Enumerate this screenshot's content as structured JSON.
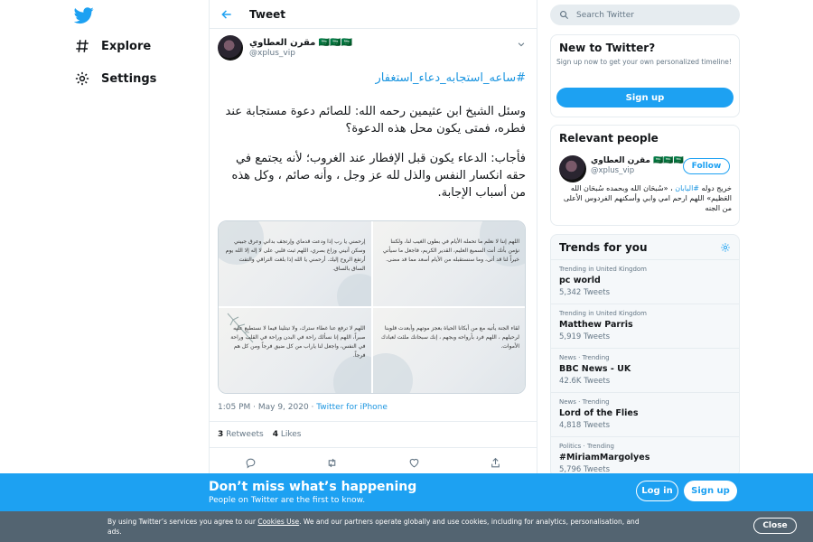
{
  "colors": {
    "accent": "#1da1f2",
    "link": "#1b95e0",
    "muted": "#657786",
    "cookie_bg": "#536471"
  },
  "nav": {
    "logo_icon": "twitter-bird-icon",
    "items": [
      {
        "label": "Explore",
        "icon": "hashtag-icon"
      },
      {
        "label": "Settings",
        "icon": "gear-icon"
      }
    ]
  },
  "header": {
    "title": "Tweet",
    "back_icon": "arrow-left-icon"
  },
  "tweet": {
    "author_name": "مقرن العطاوي 🇸🇦🇸🇦🇸🇦",
    "author_handle": "@xplus_vip",
    "hashtag": "#ساعه_استجابه_دعاء_استغفار",
    "paragraph1": "وسئل الشيخ ابن عثيمين رحمه الله: للصائم دعوة مستجابة عند فطره، فمتى يكون محل هذه الدعوة؟",
    "paragraph2": "فأجاب: الدعاء يكون قبل الإفطار عند الغروب؛ لأنه يجتمع في حقه انكسار النفس والذل لله عز وجل ، وأنه صائم ، وكل هذه من أسباب الإجابة.",
    "images": [
      {
        "text": "اللهم إننا لا نعلم ما تحمله الأيام في بطون الغيب لنا، ولكننا نؤمن بأنك أنت السميع العليم، القدير الكريم، فاجعل ما سيأتي خيراً لنا قد أتى، وما سنستقبله من الأيام أسعد مما قد مضى."
      },
      {
        "text": "إرحمني يا رب إذا ودعت قدماي وإرتجف بداني وعرق جبيني وسكن أنيني وزاغ بصري، اللهم ثبت قلبي على لا إله إلا الله يوم أرتفع الروح إليك. أرحمني يا الله إذا بلغت التراقي والتفت الساق بالساق."
      },
      {
        "text": "لقاء الجنة يأتيه مع من أبكانا الحياة بعجز موتهم وأبعدت قلوبنا لرحيلهم ، اللهم فرد بأرواحه وبجهم ، إنك سبحانك ملئت لعبادك الأموات."
      },
      {
        "text": "اللهم لا ترفع عنا غطاء سترك، ولا تبتلينا فيما لا نستطيع عليه صبراً، اللهم إنا نسألك راحة في البدن وراحة في القلب وراحة في النفس، واجعل لنا ياراب من كل ضيق فرجاً ومن كل هم فرجاً."
      }
    ],
    "timestamp": "1:05 PM · May 9, 2020 · ",
    "source": "Twitter for iPhone",
    "retweets_count": "3",
    "retweets_label": "Retweets",
    "likes_count": "4",
    "likes_label": "Likes",
    "actions": [
      "reply-icon",
      "retweet-icon",
      "like-icon",
      "share-icon"
    ]
  },
  "search": {
    "placeholder": "Search Twitter"
  },
  "new_to_twitter": {
    "title": "New to Twitter?",
    "description": "Sign up now to get your own personalized timeline!",
    "button": "Sign up"
  },
  "relevant": {
    "title": "Relevant people",
    "name": "مقرن العطاوي 🇸🇦🇸🇦🇸🇦",
    "handle": "@xplus_vip",
    "follow": "Follow",
    "bio_prefix": "خريج دوله ",
    "bio_hashtag": "#اليابان",
    "bio_rest": " ، «سُبحَان الله وبحمده سُبحَان الله العَظيم» اللهم ارحم امي وابي وأسكنهم الفردوس الأعلى من الجنه"
  },
  "trends": {
    "title": "Trends for you",
    "items": [
      {
        "context": "Trending in United Kingdom",
        "name": "pc world",
        "count": "5,342 Tweets"
      },
      {
        "context": "Trending in United Kingdom",
        "name": "Matthew Parris",
        "count": "5,919 Tweets"
      },
      {
        "context": "News · Trending",
        "name": "BBC News - UK",
        "count": "42.6K Tweets"
      },
      {
        "context": "News · Trending",
        "name": "Lord of the Flies",
        "count": "4,818 Tweets"
      },
      {
        "context": "Politics · Trending",
        "name": "#MiriamMargolyes",
        "count": "5,796 Tweets"
      }
    ]
  },
  "banner": {
    "title": "Don’t miss what’s happening",
    "subtitle": "People on Twitter are the first to know.",
    "login": "Log in",
    "signup": "Sign up"
  },
  "cookie": {
    "text_before": "By using Twitter’s services you agree to our ",
    "link": "Cookies Use",
    "text_after": ". We and our partners operate globally and use cookies, including for analytics, personalisation, and ads.",
    "close": "Close"
  }
}
